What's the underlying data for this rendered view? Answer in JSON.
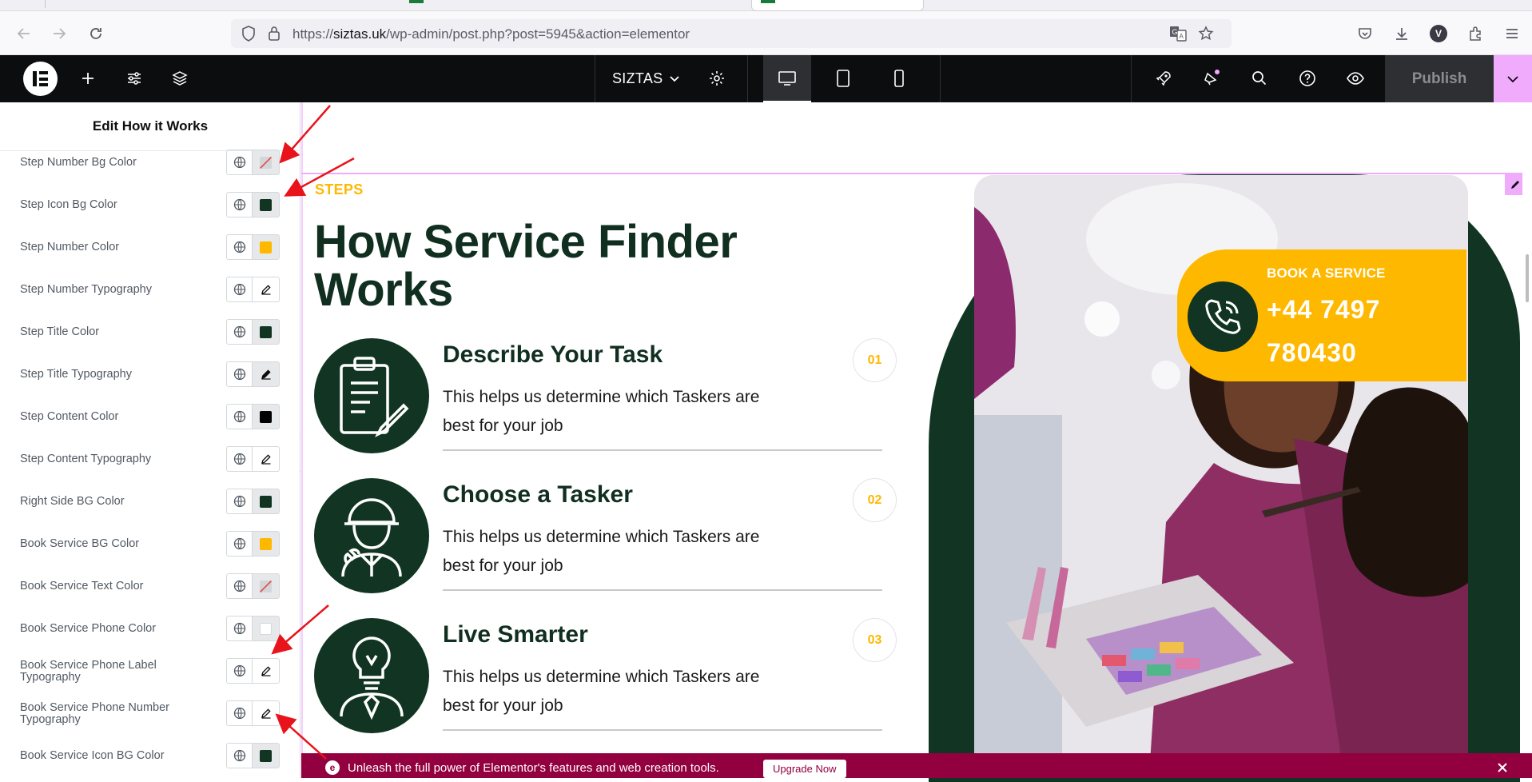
{
  "browser": {
    "url_prefix": "https://",
    "url_host": "siztas.uk",
    "url_path": "/wp-admin/post.php?post=5945&action=elementor",
    "profile_initial": "V"
  },
  "editor_bar": {
    "site_name": "SIZTAS",
    "publish_label": "Publish"
  },
  "panel": {
    "title": "Edit How it Works",
    "controls": [
      {
        "label": "Step Number Bg Color",
        "kind": "color",
        "value": "",
        "empty": true
      },
      {
        "label": "Step Icon Bg Color",
        "kind": "color",
        "value": "#113522"
      },
      {
        "label": "Step Number Color",
        "kind": "color",
        "value": "#ffb800"
      },
      {
        "label": "Step Number Typography",
        "kind": "typography"
      },
      {
        "label": "Step Title Color",
        "kind": "color",
        "value": "#113522"
      },
      {
        "label": "Step Title Typography",
        "kind": "typography",
        "active": true
      },
      {
        "label": "Step Content Color",
        "kind": "color",
        "value": "#000000"
      },
      {
        "label": "Step Content Typography",
        "kind": "typography"
      },
      {
        "label": "Right Side BG Color",
        "kind": "color",
        "value": "#113522"
      },
      {
        "label": "Book Service BG Color",
        "kind": "color",
        "value": "#ffb800"
      },
      {
        "label": "Book Service Text Color",
        "kind": "color",
        "value": "",
        "empty": true
      },
      {
        "label": "Book Service Phone Color",
        "kind": "color",
        "value": "#ffffff"
      },
      {
        "label": "Book Service Phone Label Typography",
        "kind": "typography"
      },
      {
        "label": "Book Service Phone Number Typography",
        "kind": "typography"
      },
      {
        "label": "Book Service Icon BG Color",
        "kind": "color",
        "value": "#113522"
      }
    ]
  },
  "section": {
    "kicker": "STEPS",
    "heading": "How Service Finder Works",
    "steps": [
      {
        "title": "Describe Your Task",
        "text": "This helps us determine which Taskers are best for your job",
        "number": "01",
        "icon": "clipboard-icon"
      },
      {
        "title": "Choose a Tasker",
        "text": "This helps us determine which Taskers are best for your job",
        "number": "02",
        "icon": "worker-icon"
      },
      {
        "title": "Live Smarter",
        "text": "This helps us determine which Taskers are best for your job",
        "number": "03",
        "icon": "lightbulb-person-icon"
      }
    ],
    "book": {
      "label": "BOOK A SERVICE",
      "phone": "+44 7497 780430"
    }
  },
  "notice": {
    "text": "Unleash the full power of Elementor's features and web creation tools.",
    "button": "Upgrade Now"
  },
  "colors": {
    "brand_green": "#113522",
    "accent_yellow": "#ffb800",
    "editor_pink": "#f0abfc",
    "notice_bg": "#93003f"
  }
}
